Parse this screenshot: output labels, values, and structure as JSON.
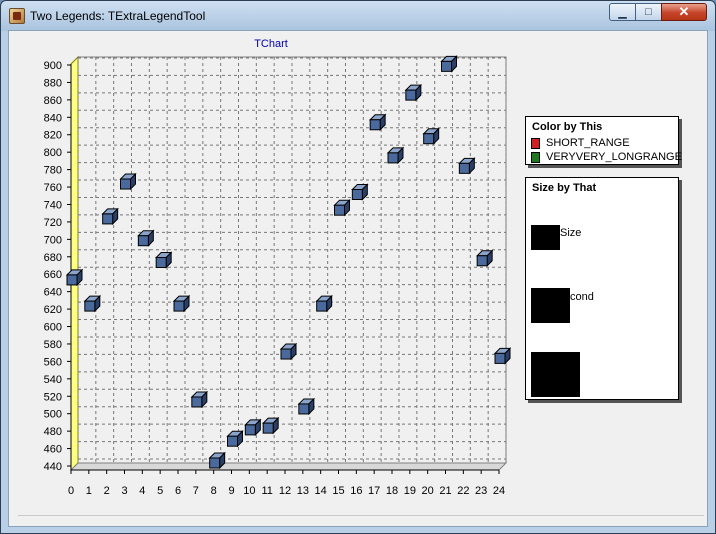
{
  "window": {
    "title": "Two Legends: TExtraLegendTool",
    "minimize_glyph": "▁",
    "maximize_glyph": "□",
    "close_glyph": "✕"
  },
  "chart_data": {
    "type": "scatter",
    "title": "TChart",
    "xlabel": "",
    "ylabel": "",
    "x": [
      0,
      1,
      2,
      3,
      4,
      5,
      6,
      7,
      8,
      9,
      10,
      11,
      12,
      13,
      14,
      15,
      16,
      17,
      18,
      19,
      20,
      21,
      22,
      23,
      24
    ],
    "y": [
      650,
      620,
      720,
      760,
      695,
      670,
      620,
      510,
      440,
      465,
      478,
      480,
      565,
      502,
      620,
      730,
      748,
      828,
      790,
      862,
      812,
      895,
      778,
      672,
      560
    ],
    "xlim": [
      0,
      24
    ],
    "ylim": [
      435,
      905
    ],
    "x_ticks": [
      0,
      1,
      2,
      3,
      4,
      5,
      6,
      7,
      8,
      9,
      10,
      11,
      12,
      13,
      14,
      15,
      16,
      17,
      18,
      19,
      20,
      21,
      22,
      23,
      24
    ],
    "y_ticks": [
      440,
      460,
      480,
      500,
      520,
      540,
      560,
      580,
      600,
      620,
      640,
      660,
      680,
      700,
      720,
      740,
      760,
      780,
      800,
      820,
      840,
      860,
      880,
      900
    ],
    "grid": true,
    "marker": "3d-cube",
    "marker_color": "#4a6a9e",
    "left_wall_color": "#ffff7f"
  },
  "legend_color": {
    "title": "Color by This",
    "items": [
      {
        "label": "SHORT_RANGE",
        "color": "#d22020"
      },
      {
        "label": "VERYVERY_LONGRANGE",
        "color": "#1f7a1f"
      }
    ]
  },
  "legend_size": {
    "title": "Size by That",
    "items": [
      {
        "label": "Size"
      },
      {
        "label": "cond"
      },
      {
        "label": ""
      }
    ]
  }
}
